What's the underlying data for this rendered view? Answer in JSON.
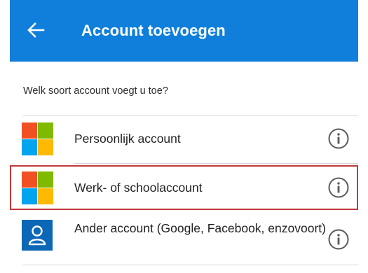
{
  "header": {
    "title": "Account toevoegen",
    "back_icon": "arrow-left-icon",
    "background": "#0f7fdb"
  },
  "prompt": "Welk soort account voegt u toe?",
  "accounts": [
    {
      "label": "Persoonlijk account",
      "icon": "microsoft-logo-icon",
      "info_icon": "info-icon"
    },
    {
      "label": "Werk- of schoolaccount",
      "icon": "microsoft-logo-icon",
      "info_icon": "info-icon",
      "highlighted": true
    },
    {
      "label": "Ander account (Google, Facebook, enzovoort)",
      "icon": "person-icon",
      "info_icon": "info-icon"
    }
  ],
  "colors": {
    "ms_red": "#f25022",
    "ms_green": "#7fba00",
    "ms_blue": "#00a4ef",
    "ms_yellow": "#ffb900",
    "person_tile": "#0c68b6",
    "highlight_border": "#c0393b"
  }
}
